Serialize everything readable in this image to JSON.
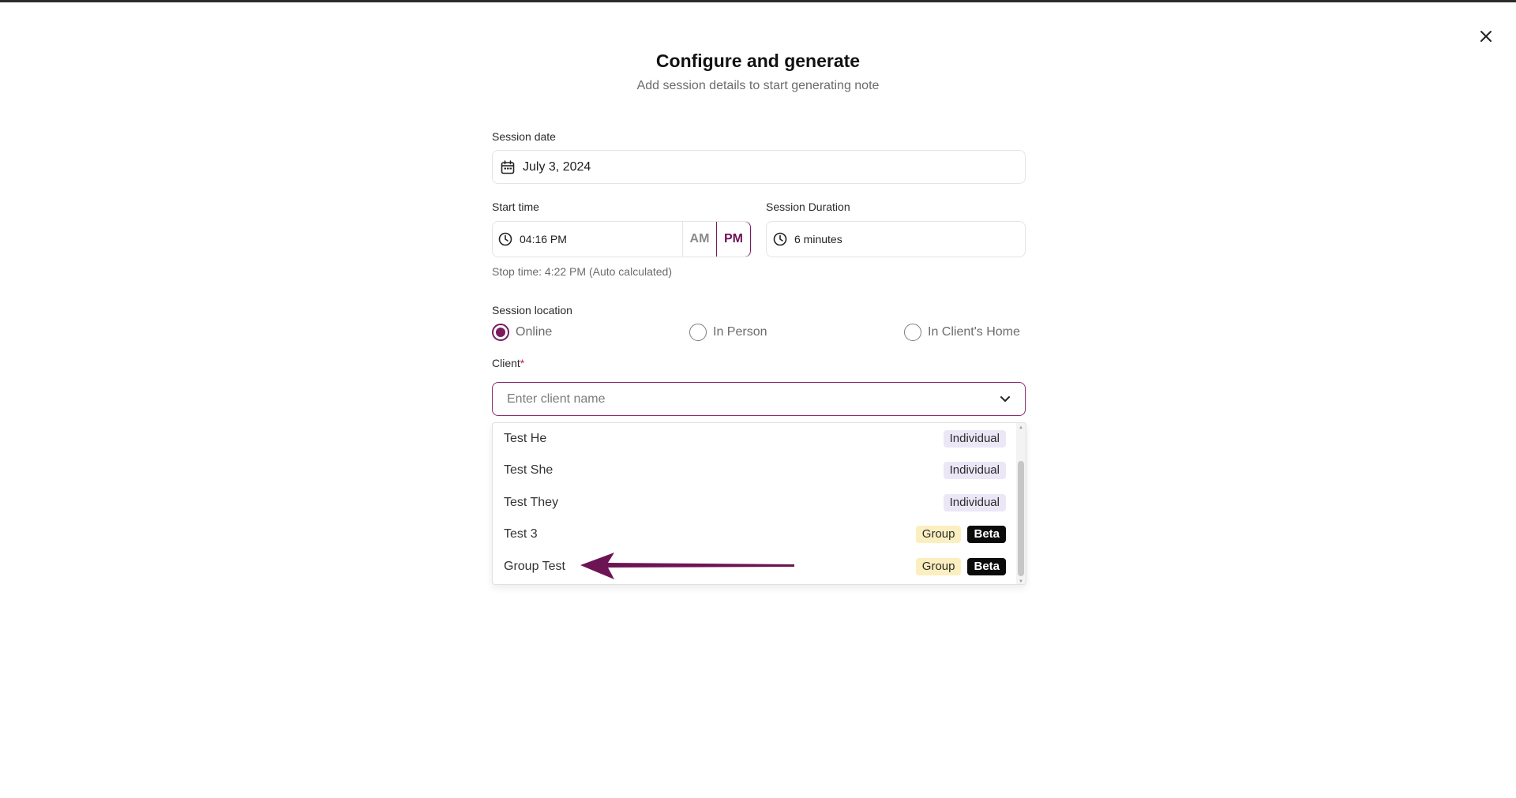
{
  "header": {
    "title": "Configure and generate",
    "subtitle": "Add session details to start generating note"
  },
  "session_date": {
    "label": "Session date",
    "value": "July 3, 2024"
  },
  "start_time": {
    "label": "Start time",
    "value": "04:16 PM",
    "am_label": "AM",
    "pm_label": "PM",
    "selected": "PM"
  },
  "session_duration": {
    "label": "Session Duration",
    "value": "6 minutes"
  },
  "stop_time_text": "Stop time: 4:22 PM (Auto calculated)",
  "session_location": {
    "label": "Session location",
    "options": [
      "Online",
      "In Person",
      "In Client's Home"
    ],
    "selected": "Online"
  },
  "client": {
    "label": "Client",
    "required_marker": "*",
    "placeholder": "Enter client name",
    "options": [
      {
        "name": "Test He",
        "tags": [
          "Individual"
        ]
      },
      {
        "name": "Test She",
        "tags": [
          "Individual"
        ]
      },
      {
        "name": "Test They",
        "tags": [
          "Individual"
        ]
      },
      {
        "name": "Test 3",
        "tags": [
          "Group",
          "Beta"
        ]
      },
      {
        "name": "Group Test",
        "tags": [
          "Group",
          "Beta"
        ]
      }
    ]
  },
  "colors": {
    "accent": "#7a1a5f",
    "individual_tag": "#ece7f6",
    "group_tag": "#fbefc0",
    "beta_tag": "#0b0b0b"
  },
  "icons": [
    "close-icon",
    "calendar-icon",
    "clock-icon",
    "chevron-down-icon",
    "arrow-annotation"
  ]
}
